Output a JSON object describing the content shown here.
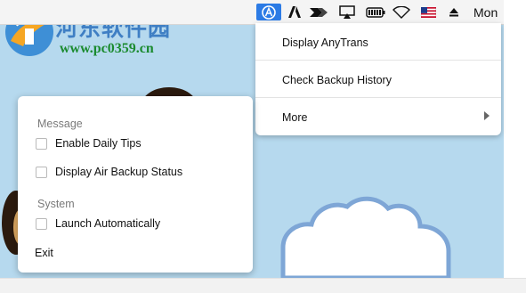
{
  "watermark": {
    "site_name": "河东软件园",
    "url": "www.pc0359.cn"
  },
  "menubar": {
    "icons": [
      "anytrans-icon",
      "adobe-icon",
      "bar-chart-icon",
      "airplay-icon",
      "battery-icon",
      "wifi-icon",
      "us-flag-icon",
      "eject-icon"
    ],
    "clock": "Mon"
  },
  "dropdown": {
    "items": [
      {
        "label": "Display AnyTrans"
      },
      {
        "label": "Check Backup History"
      },
      {
        "label": "More"
      }
    ]
  },
  "panel": {
    "sections": [
      {
        "title": "Message",
        "options": [
          {
            "label": "Enable Daily Tips",
            "checked": false
          },
          {
            "label": "Display Air Backup Status",
            "checked": false
          }
        ]
      },
      {
        "title": "System",
        "options": [
          {
            "label": "Launch Automatically",
            "checked": false
          }
        ]
      }
    ],
    "exit_label": "Exit"
  },
  "colors": {
    "desktop_background": "#b6d9ee",
    "anytrans_accent": "#2c7be5",
    "watermark_text": "#3f7fc4",
    "watermark_url": "#1b8b2f"
  }
}
